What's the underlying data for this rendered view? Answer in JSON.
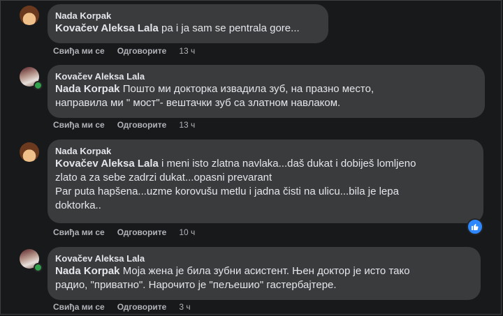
{
  "actions": {
    "like": "Свиђа ми се",
    "reply": "Одговорите"
  },
  "comments": [
    {
      "author": "Nada Korpak",
      "mention": "Kovačev Aleksa Lala",
      "lines": [
        " ра і ја sam se pentrala gore..."
      ],
      "time": "13 ч"
    },
    {
      "author": "Kovačev Aleksa Lala",
      "mention": "Nada Korpak",
      "lines": [
        " Пошто ми докторка извадила зуб, на празно место,",
        "направила ми \" мост\"- вештачки зуб са златном навлаком."
      ],
      "time": "13 ч"
    },
    {
      "author": "Nada Korpak",
      "mention": "Kovačev Aleksa Lala",
      "lines": [
        " i meni isto zlatna navlaka...daš dukat i dobiješ lomljeno",
        "zlato a za sebe zadrzi dukat...opasni prevarant",
        "Par puta hapšena...uzme korovušu metlu i jadna čisti na ulicu...bila je lepa",
        "doktorka.."
      ],
      "time": "10 ч",
      "reactions": "like-icon"
    },
    {
      "author": "Kovačev Aleksa Lala",
      "mention": "Nada Korpak",
      "lines": [
        " Моја жена је била зубни асистент. Њен доктор је исто тако",
        "радио, \"приватно\". Нарочито је \"пељешио\" гастербајтере."
      ],
      "time": "3 ч"
    }
  ]
}
